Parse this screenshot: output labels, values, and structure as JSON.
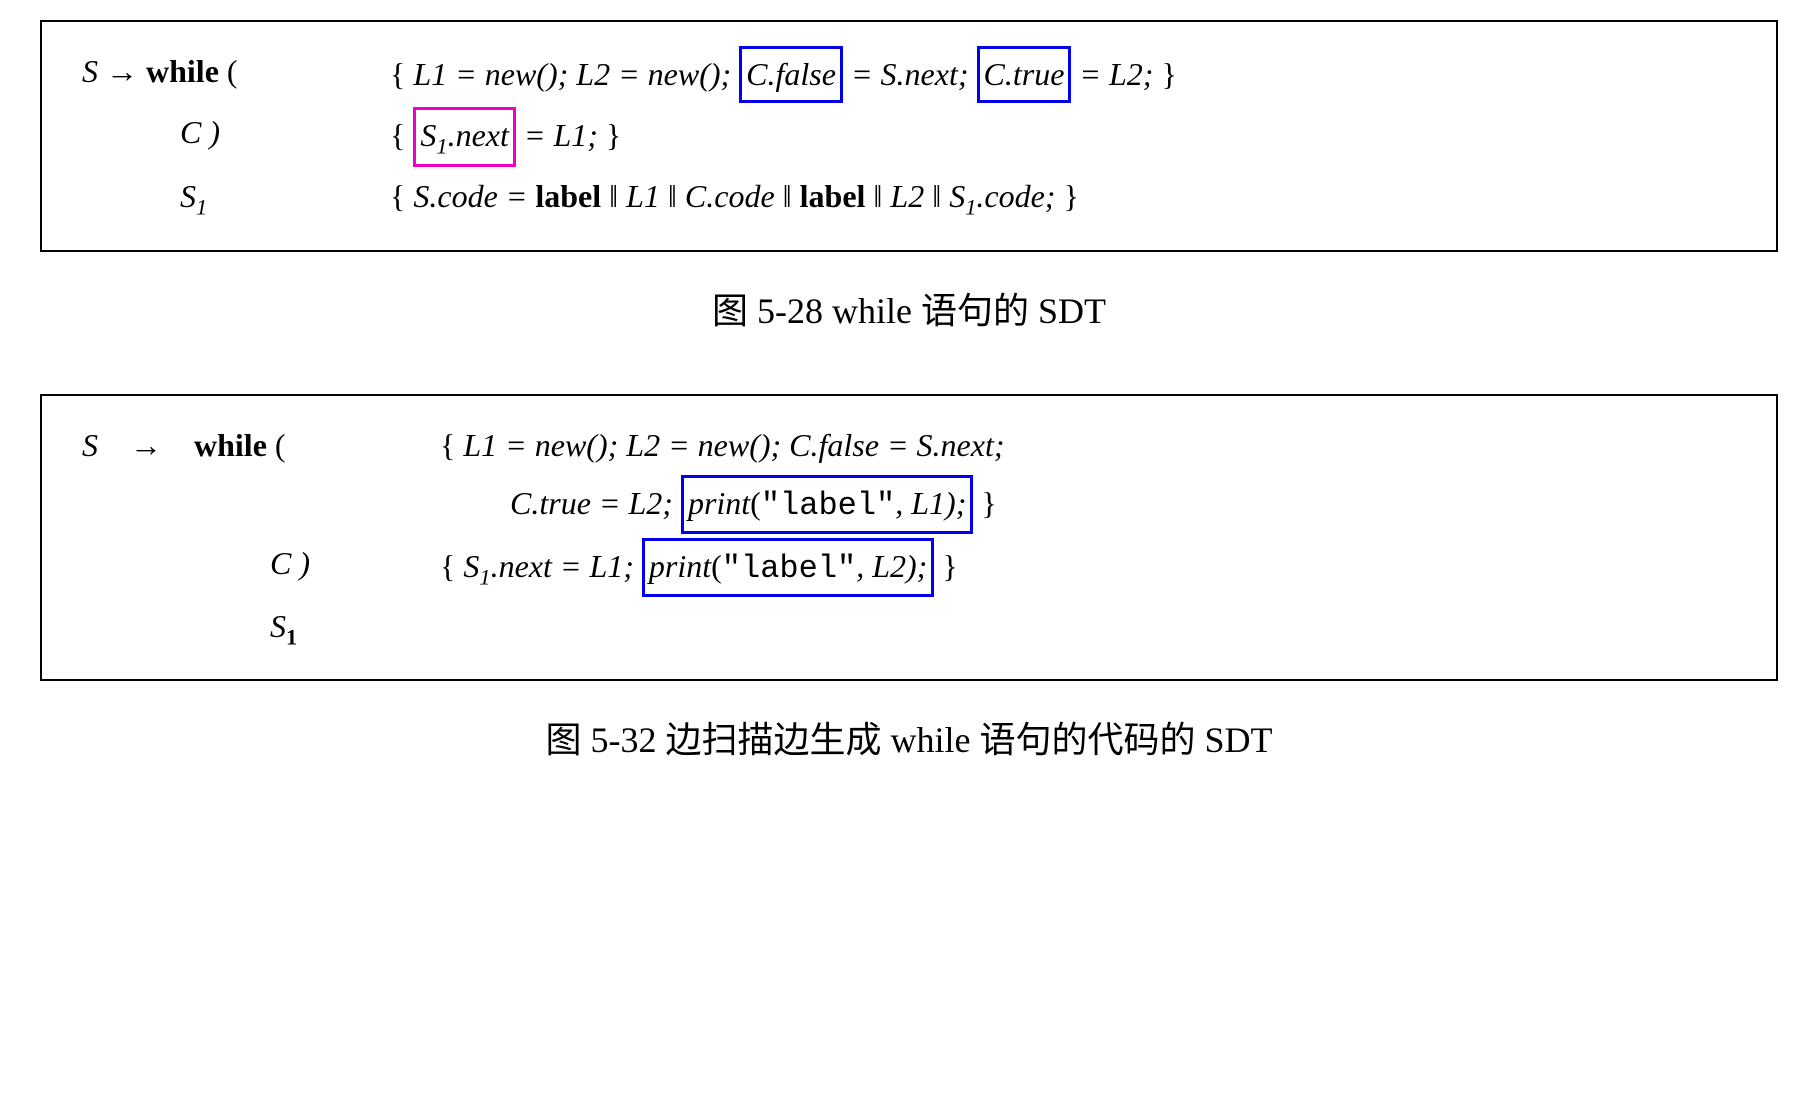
{
  "fig1": {
    "caption": "图 5-28    while 语句的 SDT",
    "line1": {
      "lhs": "S → while (",
      "open": "{ ",
      "a": "L1 = new();  L2 = new(); ",
      "box1": "C.false",
      "mid1": " = S.next; ",
      "box2": "C.true",
      "mid2": " = L2;",
      "close": " }"
    },
    "line2": {
      "lhs": "C )",
      "open": "{ ",
      "box": "S",
      "boxsub": "1",
      "boxrest": ".next",
      "mid": " = L1;",
      "close": " }"
    },
    "line3": {
      "lhs_s": "S",
      "lhs_sub": "1",
      "open": "{ ",
      "a": "S.code = ",
      "label": "label",
      "b": " ‖ L1 ‖ C.code ‖ ",
      "label2": "label",
      "c": " ‖ L2 ‖ S",
      "sub": "1",
      "d": ".code;",
      "close": " }"
    }
  },
  "fig2": {
    "caption": "图 5-32    边扫描边生成 while 语句的代码的 SDT",
    "line1": {
      "s": "S",
      "arrow": "→",
      "while": "while (",
      "open": "{ ",
      "a": "L1 = new();  L2 = new();  C.false = S.next;"
    },
    "line2": {
      "a": "C.true = L2; ",
      "box_print": "print",
      "box_rest": "(\"label\", L1);",
      "close": " }"
    },
    "line3": {
      "lhs": "C )",
      "open": "{ ",
      "a": "S",
      "sub": "1",
      "b": ".next = L1; ",
      "box_print": "print",
      "box_rest": "(\"label\", L2);",
      "close": " }"
    },
    "line4": {
      "s": "S",
      "sub": "1"
    }
  }
}
